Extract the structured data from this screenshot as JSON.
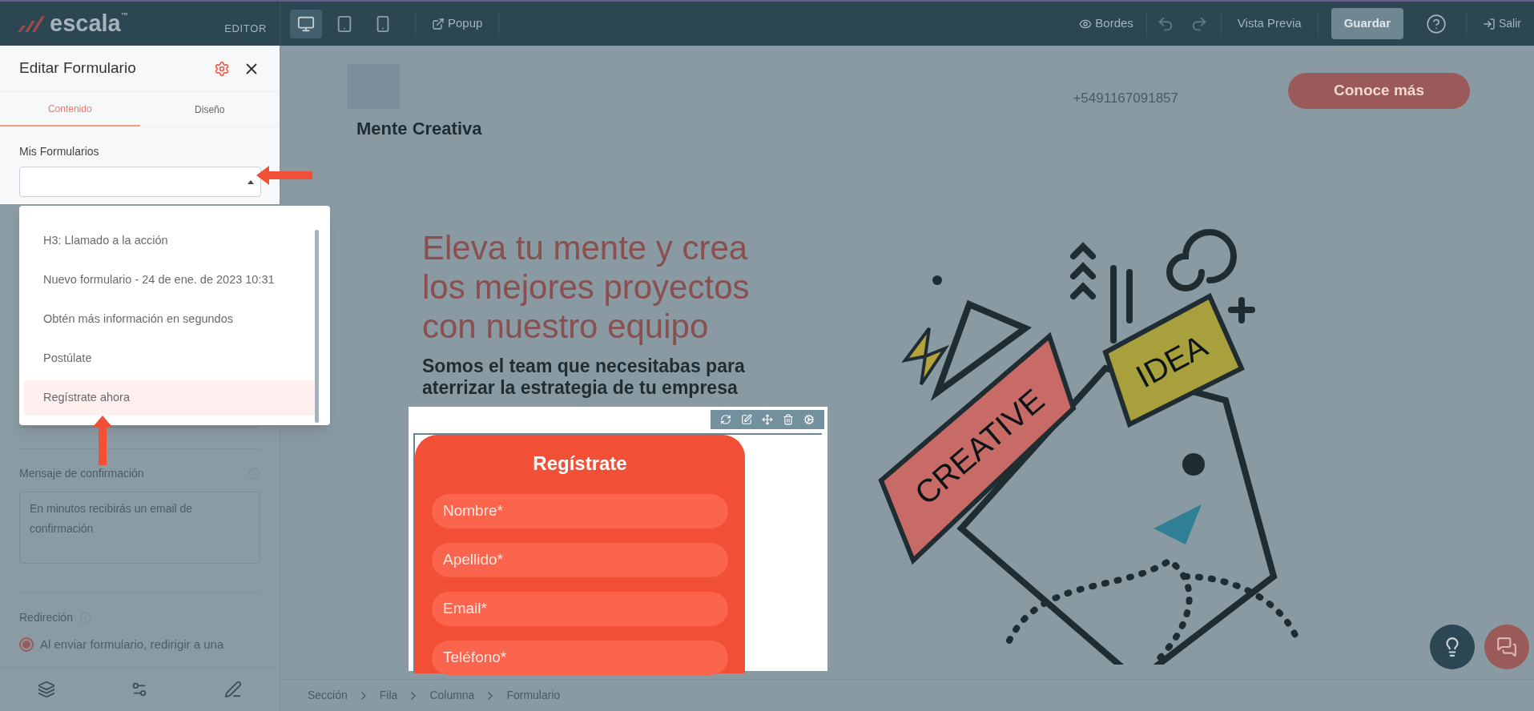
{
  "topbar": {
    "logo": "escala",
    "trademark": "™",
    "mode": "EDITOR",
    "devices": [
      {
        "kind": "desktop",
        "selected": true
      },
      {
        "kind": "tablet",
        "selected": false
      },
      {
        "kind": "mobile",
        "selected": false
      }
    ],
    "popup": "Popup",
    "borders": "Bordes",
    "preview": "Vista Previa",
    "save": {
      "label": "Guardar",
      "disabled": true
    },
    "exit": "Salir"
  },
  "panel": {
    "title": "Editar Formulario",
    "tabs": [
      {
        "label": "Contenido",
        "selected": true
      },
      {
        "label": "Diseño",
        "selected": false
      }
    ],
    "forms_label": "Mis Formularios",
    "confirmation_label": "Mensaje de confirmación",
    "confirmation_value": "En minutos recibirás un email de confirmación",
    "redirect_label": "Redireción",
    "redirect_option": {
      "label": "Al enviar formulario, redirigir a una",
      "checked": true
    }
  },
  "dropdown": [
    {
      "label": "H3: Llamado a la acción",
      "selected": false
    },
    {
      "label": "Nuevo formulario - 24 de ene. de 2023 10:31",
      "selected": false
    },
    {
      "label": "Obtén más información en segundos",
      "selected": false
    },
    {
      "label": "Postúlate",
      "selected": false
    },
    {
      "label": "Regístrate ahora",
      "selected": true
    }
  ],
  "site": {
    "brand": "Mente Creativa",
    "phone": "+5491167091857",
    "cta": "Conoce más",
    "headline": "Eleva tu mente y crea los mejores proyectos con nuestro equipo",
    "subheading": "Somos el team que necesitabas para aterrizar la estrategia de tu empresa",
    "form": {
      "title": "Regístrate",
      "fields": [
        "Nombre*",
        "Apellido*",
        "Email*",
        "Teléfono*"
      ]
    },
    "illustration": {
      "left_banner": "CREATIVE",
      "right_banner": "IDEA"
    }
  },
  "breadcrumb": [
    "Sección",
    "Fila",
    "Columna",
    "Formulario"
  ]
}
